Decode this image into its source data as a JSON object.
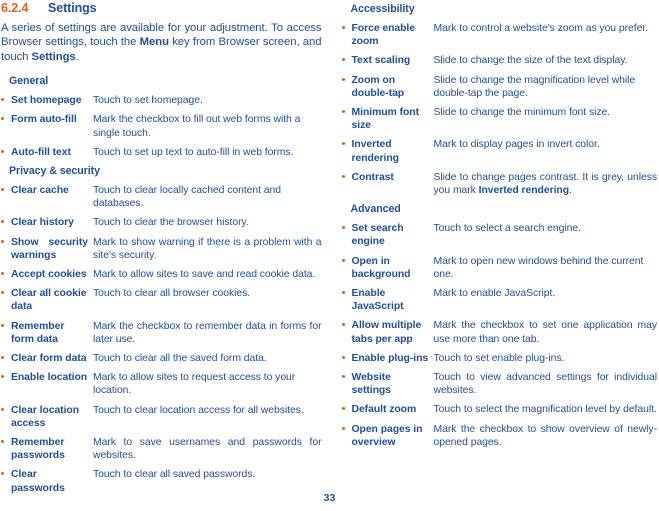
{
  "heading": {
    "number": "6.2.4",
    "title": "Settings"
  },
  "intro": {
    "part1": "A series of settings are available for your adjustment. To access Browser settings, touch the ",
    "bold1": "Menu",
    "part2": " key from Browser screen, and touch ",
    "bold2": "Settings",
    "part3": "."
  },
  "page_number": "33",
  "colors": {
    "accent_orange": "#e1601f",
    "text_blue": "#1f4f9a"
  },
  "left_column": {
    "sections": [
      {
        "title": "General",
        "items": [
          {
            "term": "Set homepage",
            "desc": "Touch to set homepage."
          },
          {
            "term": "Form auto-fill",
            "desc": "Mark the checkbox to fill out web forms with a single touch."
          },
          {
            "term": "Auto-fill text",
            "desc": "Touch to set up text to auto-fill in web forms."
          }
        ]
      },
      {
        "title": "Privacy & security",
        "items": [
          {
            "term": "Clear cache",
            "desc": "Touch to clear locally cached content and databases."
          },
          {
            "term": "Clear history",
            "desc": "Touch to clear the browser history."
          },
          {
            "term": "Show security warnings",
            "desc": "Mark to show warning if there is a problem with a site's security."
          },
          {
            "term": "Accept cookies",
            "desc": "Mark to allow sites to save and read cookie data."
          },
          {
            "term": "Clear all cookie data",
            "desc": "Touch to clear all browser cookies."
          },
          {
            "term": "Remember form data",
            "desc": "Mark the checkbox to remember data in forms for later use."
          },
          {
            "term": "Clear form data",
            "desc": "Touch to clear all the saved form data."
          },
          {
            "term": "Enable location",
            "desc": "Mark to allow sites to request access to your location."
          },
          {
            "term": "Clear location access",
            "desc": "Touch to clear location access for all websites."
          },
          {
            "term": "Remember passwords",
            "desc": "Mark to save usernames and passwords for websites."
          },
          {
            "term": "Clear passwords",
            "desc": "Touch to clear all saved passwords."
          }
        ]
      }
    ]
  },
  "right_column": {
    "sections": [
      {
        "title": "Accessibility",
        "items": [
          {
            "term": "Force enable zoom",
            "desc": "Mark to control a website's zoom as you prefer."
          },
          {
            "term": "Text scaling",
            "desc": "Slide to change the size of the text display."
          },
          {
            "term": "Zoom on double-tap",
            "desc": "Slide to change the magnification level while double-tap the page."
          },
          {
            "term": "Minimum font size",
            "desc": "Slide to change the minimum font size."
          },
          {
            "term": "Inverted rendering",
            "desc": "Mark to display pages in invert color."
          },
          {
            "term": "Contrast",
            "desc_part1": "Slide to change pages contrast. It is grey, unless you mark ",
            "desc_bold": "Inverted rendering",
            "desc_part2": "."
          }
        ]
      },
      {
        "title": "Advanced",
        "items": [
          {
            "term": "Set search engine",
            "desc": "Touch to select a search engine."
          },
          {
            "term": "Open in background",
            "desc": "Mark to open new windows behind the current one."
          },
          {
            "term": "Enable JavaScript",
            "desc": "Mark to enable JavaScript."
          },
          {
            "term": "Allow multiple tabs per app",
            "desc": "Mark the checkbox to set one application may use more than one tab."
          },
          {
            "term": "Enable plug-ins",
            "desc": "Touch to set enable plug-ins."
          },
          {
            "term": "Website settings",
            "desc": "Touch to view advanced settings for individual websites."
          },
          {
            "term": "Default zoom",
            "desc": "Touch to select the magnification level by default."
          },
          {
            "term": "Open pages in overview",
            "desc": "Mark the checkbox to show overview of newly-opened pages."
          }
        ]
      }
    ]
  }
}
